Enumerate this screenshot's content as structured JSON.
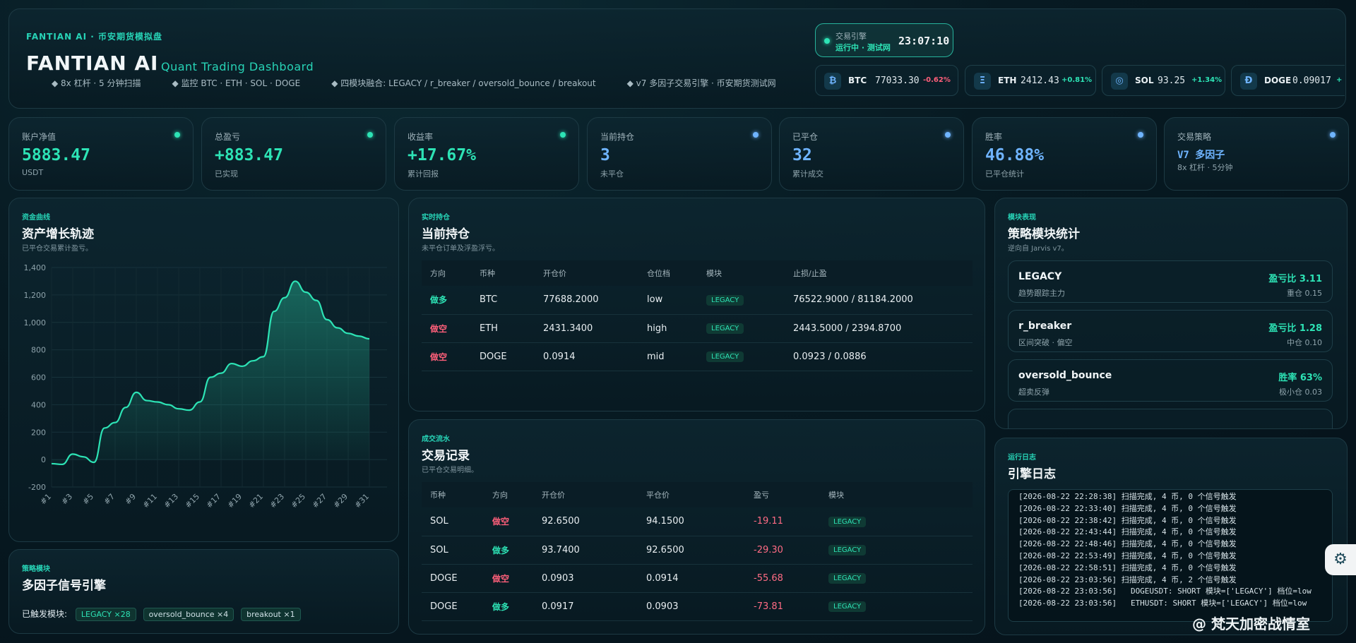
{
  "header": {
    "brand_small": "FANTIAN AI · 币安期货模拟盘",
    "brand_big": "FANTIAN AI",
    "brand_sub": "Quant Trading Dashboard",
    "features": [
      "◆ 8x 杠杆 · 5 分钟扫描",
      "◆ 监控 BTC · ETH · SOL · DOGE",
      "◆ 四模块融合: LEGACY / r_breaker / oversold_bounce / breakout",
      "◆ v7 多因子交易引擎 · 币安期货测试网"
    ],
    "engine_label": "交易引擎",
    "engine_status": "运行中 · 测试网",
    "engine_time": "23:07:10"
  },
  "tickers": [
    {
      "icon": "₿",
      "symbol": "BTC",
      "price": "77033.30",
      "change": "-0.62%",
      "dir": "down"
    },
    {
      "icon": "Ξ",
      "symbol": "ETH",
      "price": "2412.43",
      "change": "+0.81%",
      "dir": "up"
    },
    {
      "icon": "◎",
      "symbol": "SOL",
      "price": "93.25",
      "change": "+1.34%",
      "dir": "up"
    },
    {
      "icon": "Ð",
      "symbol": "DOGE",
      "price": "0.09017",
      "change": "+",
      "dir": "up"
    }
  ],
  "cards": [
    {
      "label": "账户净值",
      "value": "5883.47",
      "sub": "USDT",
      "color": "#2de3b5"
    },
    {
      "label": "总盈亏",
      "value": "+883.47",
      "sub": "已实现",
      "color": "#2de3b5"
    },
    {
      "label": "收益率",
      "value": "+17.67%",
      "sub": "累计回报",
      "color": "#2de3b5"
    },
    {
      "label": "当前持仓",
      "value": "3",
      "sub": "未平仓",
      "color": "#6fb4ff"
    },
    {
      "label": "已平仓",
      "value": "32",
      "sub": "累计成交",
      "color": "#6fb4ff"
    },
    {
      "label": "胜率",
      "value": "46.88%",
      "sub": "已平仓统计",
      "color": "#6fb4ff"
    },
    {
      "label": "交易策略",
      "value": "V7 多因子",
      "sub": "8x 杠杆 · 5分钟",
      "color": "#6fb4ff"
    }
  ],
  "equity": {
    "tag": "资金曲线",
    "title": "资产增长轨迹",
    "sub": "已平仓交易累计盈亏。"
  },
  "chart_data": {
    "type": "area",
    "title": "资产增长轨迹",
    "x": [
      "#1",
      "#2",
      "#3",
      "#4",
      "#5",
      "#6",
      "#7",
      "#8",
      "#9",
      "#10",
      "#11",
      "#12",
      "#13",
      "#14",
      "#15",
      "#16",
      "#17",
      "#18",
      "#19",
      "#20",
      "#21",
      "#22",
      "#23",
      "#24",
      "#25",
      "#26",
      "#27",
      "#28",
      "#29",
      "#30",
      "#31",
      "#32"
    ],
    "xticks": [
      "#1",
      "#3",
      "#5",
      "#7",
      "#9",
      "#11",
      "#13",
      "#15",
      "#17",
      "#19",
      "#21",
      "#23",
      "#25",
      "#27",
      "#29",
      "#31"
    ],
    "values": [
      -30,
      -35,
      40,
      20,
      -20,
      230,
      270,
      380,
      490,
      430,
      420,
      400,
      370,
      360,
      420,
      600,
      630,
      700,
      680,
      720,
      750,
      1080,
      1180,
      1300,
      1220,
      1160,
      1020,
      960,
      920,
      900,
      880
    ],
    "ylim": [
      -200,
      1400
    ],
    "yticks": [
      "1,400",
      "1,200",
      "1,000",
      "800",
      "600",
      "400",
      "200",
      "0",
      "-200"
    ],
    "ytick_vals": [
      1400,
      1200,
      1000,
      800,
      600,
      400,
      200,
      0,
      -200
    ],
    "line_color": "#2de3b5",
    "grid": true
  },
  "positions": {
    "tag": "实时持仓",
    "title": "当前持仓",
    "sub": "未平仓订单及浮盈浮亏。",
    "headers": [
      "方向",
      "币种",
      "开仓价",
      "仓位档",
      "模块",
      "止损/止盈"
    ],
    "rows": [
      {
        "dir": "做多",
        "dir_class": "dir-long",
        "coin": "BTC",
        "entry": "77688.2000",
        "tier": "low",
        "module": "LEGACY",
        "sltp": "76522.9000 / 81184.2000"
      },
      {
        "dir": "做空",
        "dir_class": "dir-short",
        "coin": "ETH",
        "entry": "2431.3400",
        "tier": "high",
        "module": "LEGACY",
        "sltp": "2443.5000 / 2394.8700"
      },
      {
        "dir": "做空",
        "dir_class": "dir-short",
        "coin": "DOGE",
        "entry": "0.0914",
        "tier": "mid",
        "module": "LEGACY",
        "sltp": "0.0923 / 0.0886"
      }
    ]
  },
  "trades": {
    "tag": "成交流水",
    "title": "交易记录",
    "sub": "已平仓交易明细。",
    "headers": [
      "币种",
      "方向",
      "开仓价",
      "平仓价",
      "盈亏",
      "模块"
    ],
    "rows": [
      {
        "coin": "SOL",
        "dir": "做空",
        "dir_class": "dir-short",
        "entry": "92.6500",
        "exit": "94.1500",
        "pnl": "-19.11",
        "module": "LEGACY"
      },
      {
        "coin": "SOL",
        "dir": "做多",
        "dir_class": "dir-long",
        "entry": "93.7400",
        "exit": "92.6500",
        "pnl": "-29.30",
        "module": "LEGACY"
      },
      {
        "coin": "DOGE",
        "dir": "做空",
        "dir_class": "dir-short",
        "entry": "0.0903",
        "exit": "0.0914",
        "pnl": "-55.68",
        "module": "LEGACY"
      },
      {
        "coin": "DOGE",
        "dir": "做多",
        "dir_class": "dir-long",
        "entry": "0.0917",
        "exit": "0.0903",
        "pnl": "-73.81",
        "module": "LEGACY"
      }
    ]
  },
  "strategy": {
    "tag": "模块表现",
    "title": "策略模块统计",
    "sub": "逆向自 Jarvis v7。",
    "items": [
      {
        "name": "LEGACY",
        "desc": "趋势跟踪主力",
        "ratio": "盈亏比 3.11",
        "detail": "重仓 0.15"
      },
      {
        "name": "r_breaker",
        "desc": "区间突破 · 偏空",
        "ratio": "盈亏比 1.28",
        "detail": "中仓 0.10"
      },
      {
        "name": "oversold_bounce",
        "desc": "超卖反弹",
        "ratio": "胜率 63%",
        "detail": "极小仓 0.03"
      }
    ]
  },
  "signal": {
    "tag": "策略模块",
    "title": "多因子信号引擎",
    "triggered_label": "已触发模块:",
    "chips": [
      "LEGACY ×28",
      "oversold_bounce ×4",
      "breakout ×1"
    ]
  },
  "log": {
    "tag": "运行日志",
    "title": "引擎日志",
    "lines": [
      "[2026-08-22 22:28:38] 扫描完成, 4 币, 0 个信号触发",
      "[2026-08-22 22:33:40] 扫描完成, 4 币, 0 个信号触发",
      "[2026-08-22 22:38:42] 扫描完成, 4 币, 0 个信号触发",
      "[2026-08-22 22:43:44] 扫描完成, 4 币, 0 个信号触发",
      "[2026-08-22 22:48:46] 扫描完成, 4 币, 0 个信号触发",
      "[2026-08-22 22:53:49] 扫描完成, 4 币, 0 个信号触发",
      "[2026-08-22 22:58:51] 扫描完成, 4 币, 0 个信号触发",
      "[2026-08-22 23:03:56] 扫描完成, 4 币, 2 个信号触发",
      "[2026-08-22 23:03:56]   DOGEUSDT: SHORT 模块=['LEGACY'] 档位=low",
      "[2026-08-22 23:03:56]   ETHUSDT: SHORT 模块=['LEGACY'] 档位=low"
    ]
  },
  "watermark": "@ 梵天加密战情室"
}
